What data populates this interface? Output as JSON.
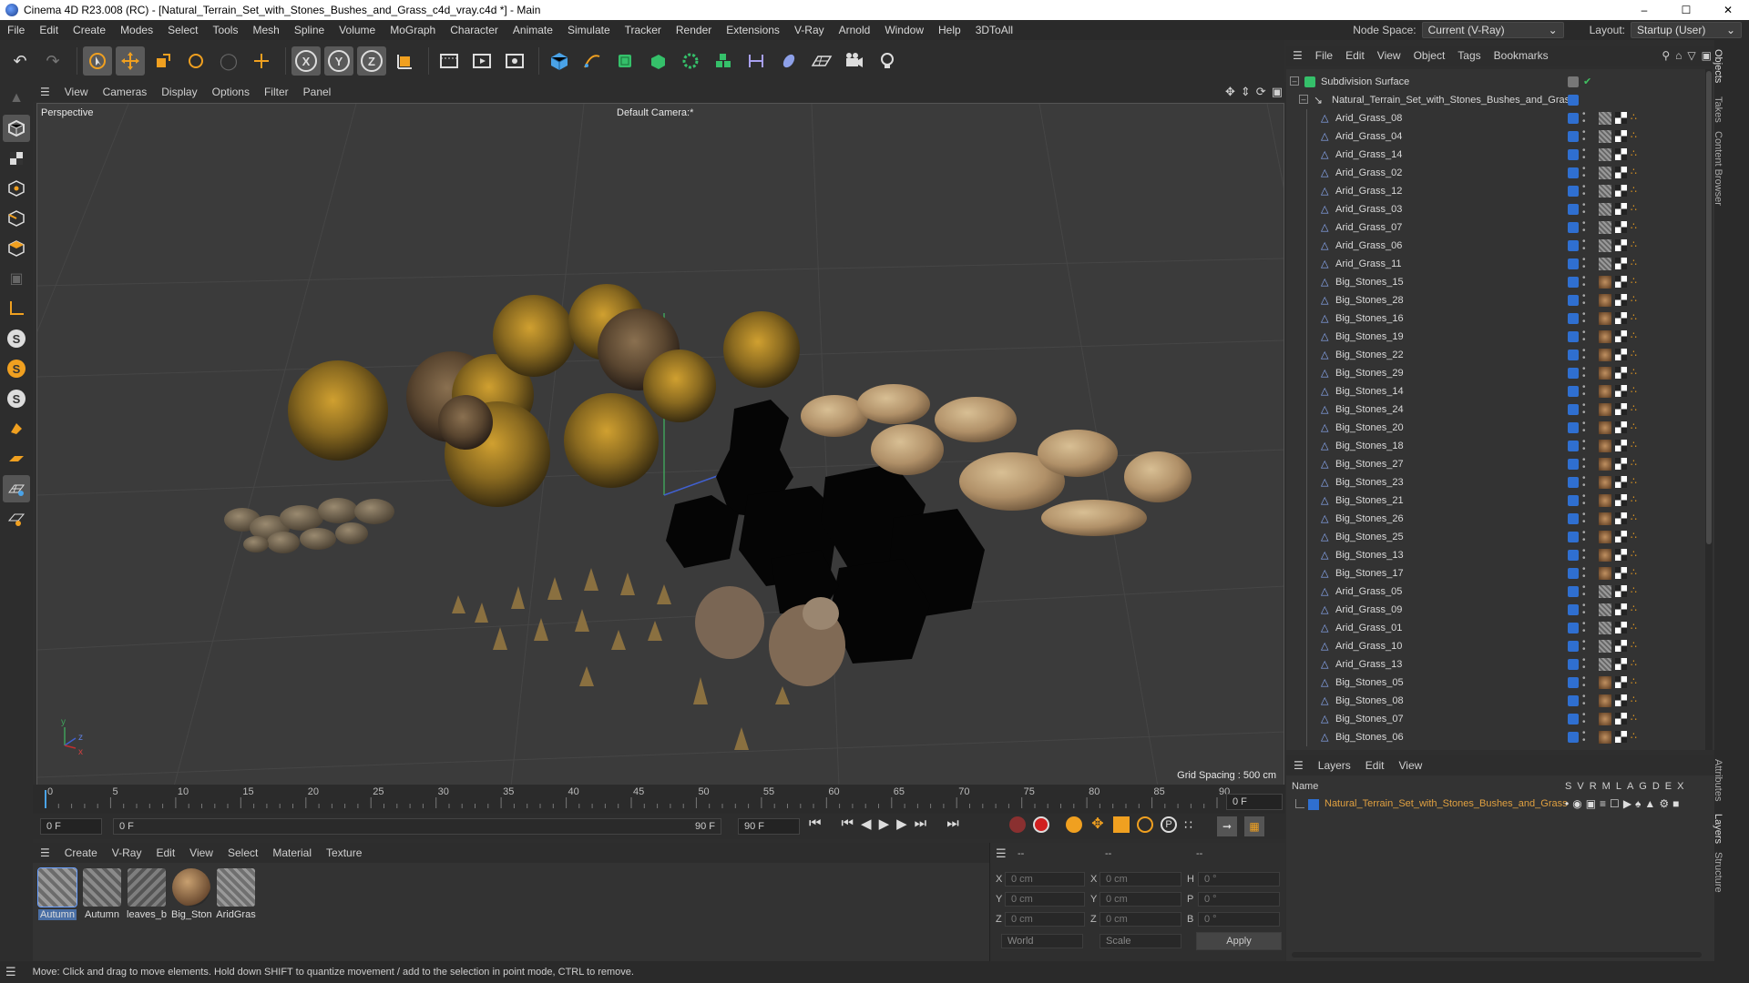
{
  "window": {
    "title": "Cinema 4D R23.008 (RC) - [Natural_Terrain_Set_with_Stones_Bushes_and_Grass_c4d_vray.c4d *] - Main",
    "controls": [
      "minimize",
      "maximize",
      "close"
    ]
  },
  "menubar": {
    "items": [
      "File",
      "Edit",
      "Create",
      "Modes",
      "Select",
      "Tools",
      "Mesh",
      "Spline",
      "Volume",
      "MoGraph",
      "Character",
      "Animate",
      "Simulate",
      "Tracker",
      "Render",
      "Extensions",
      "V-Ray",
      "Arnold",
      "Window",
      "Help",
      "3DToAll"
    ],
    "node_space_label": "Node Space:",
    "node_space_value": "Current (V-Ray)",
    "layout_label": "Layout:",
    "layout_value": "Startup (User)"
  },
  "toolbar": {
    "axis_x": "X",
    "axis_y": "Y",
    "axis_z": "Z"
  },
  "viewport": {
    "menu": [
      "View",
      "Cameras",
      "Display",
      "Options",
      "Filter",
      "Panel"
    ],
    "label": "Perspective",
    "camera": "Default Camera",
    "camera_suffix": ":*",
    "grid_spacing": "Grid Spacing : 500 cm"
  },
  "timeline": {
    "ticks": [
      "0",
      "5",
      "10",
      "15",
      "20",
      "25",
      "30",
      "35",
      "40",
      "45",
      "50",
      "55",
      "60",
      "65",
      "70",
      "75",
      "80",
      "85",
      "90"
    ],
    "current_frame": "0 F"
  },
  "transport": {
    "start_field": "0 F",
    "range_start": "0 F",
    "range_end": "90 F",
    "end_field": "90 F"
  },
  "material_manager": {
    "menu": [
      "Create",
      "V-Ray",
      "Edit",
      "View",
      "Select",
      "Material",
      "Texture"
    ],
    "materials": [
      {
        "label": "Autumn",
        "color": "#8a8a8a"
      },
      {
        "label": "Autumn",
        "color": "#7d7d7d"
      },
      {
        "label": "leaves_b",
        "color": "#6f6f6f"
      },
      {
        "label": "Big_Ston",
        "color": "#a08060"
      },
      {
        "label": "AridGras",
        "color": "#808080"
      }
    ]
  },
  "coordinates": {
    "header": [
      "--",
      "--",
      "--"
    ],
    "rows": [
      {
        "a": "X",
        "av": "0 cm",
        "b": "X",
        "bv": "0 cm",
        "c": "H",
        "cv": "0 °"
      },
      {
        "a": "Y",
        "av": "0 cm",
        "b": "Y",
        "bv": "0 cm",
        "c": "P",
        "cv": "0 °"
      },
      {
        "a": "Z",
        "av": "0 cm",
        "b": "Z",
        "bv": "0 cm",
        "c": "B",
        "cv": "0 °"
      }
    ],
    "mode1": "World",
    "mode2": "Scale",
    "apply": "Apply"
  },
  "status": {
    "text": "Move: Click and drag to move elements. Hold down SHIFT to quantize movement / add to the selection in point mode, CTRL to remove."
  },
  "object_manager": {
    "menu": [
      "File",
      "Edit",
      "View",
      "Object",
      "Tags",
      "Bookmarks"
    ],
    "root": "Subdivision Surface",
    "group": "Natural_Terrain_Set_with_Stones_Bushes_and_Grass",
    "objects": [
      "Arid_Grass_08",
      "Arid_Grass_04",
      "Arid_Grass_14",
      "Arid_Grass_02",
      "Arid_Grass_12",
      "Arid_Grass_03",
      "Arid_Grass_07",
      "Arid_Grass_06",
      "Arid_Grass_11",
      "Big_Stones_15",
      "Big_Stones_28",
      "Big_Stones_16",
      "Big_Stones_19",
      "Big_Stones_22",
      "Big_Stones_29",
      "Big_Stones_14",
      "Big_Stones_24",
      "Big_Stones_20",
      "Big_Stones_18",
      "Big_Stones_27",
      "Big_Stones_23",
      "Big_Stones_21",
      "Big_Stones_26",
      "Big_Stones_25",
      "Big_Stones_13",
      "Big_Stones_17",
      "Arid_Grass_05",
      "Arid_Grass_09",
      "Arid_Grass_01",
      "Arid_Grass_10",
      "Arid_Grass_13",
      "Big_Stones_05",
      "Big_Stones_08",
      "Big_Stones_07",
      "Big_Stones_06"
    ]
  },
  "layers": {
    "menu": [
      "Layers",
      "Edit",
      "View"
    ],
    "col_name": "Name",
    "flags": [
      "S",
      "V",
      "R",
      "M",
      "L",
      "A",
      "G",
      "D",
      "E",
      "X"
    ],
    "layer_name": "Natural_Terrain_Set_with_Stones_Bushes_and_Grass"
  },
  "side_tabs": [
    "Objects",
    "Takes",
    "Content Browser",
    "Attributes",
    "Layers",
    "Structure"
  ]
}
